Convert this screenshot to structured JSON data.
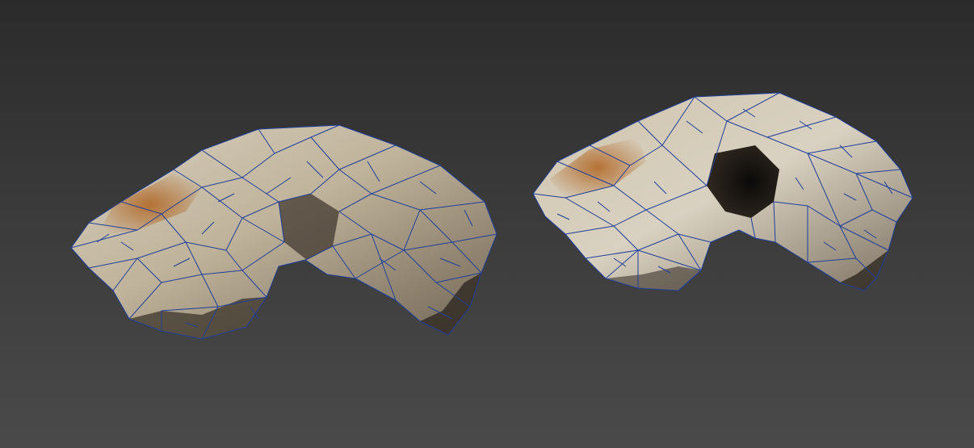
{
  "viewport": {
    "name": "3D viewport",
    "background_top": "#2b2b2b",
    "background_bottom": "#4a4a4a"
  },
  "models": [
    {
      "id": "skull-left",
      "view": "perspective-left"
    },
    {
      "id": "skull-right",
      "view": "perspective-right"
    }
  ],
  "style": {
    "wire_color": "#1f3f9a",
    "bone_light": "#e2dccd",
    "bone_mid": "#b9ad94",
    "bone_shadow": "#4a3f33",
    "stain": "#a85f25"
  }
}
